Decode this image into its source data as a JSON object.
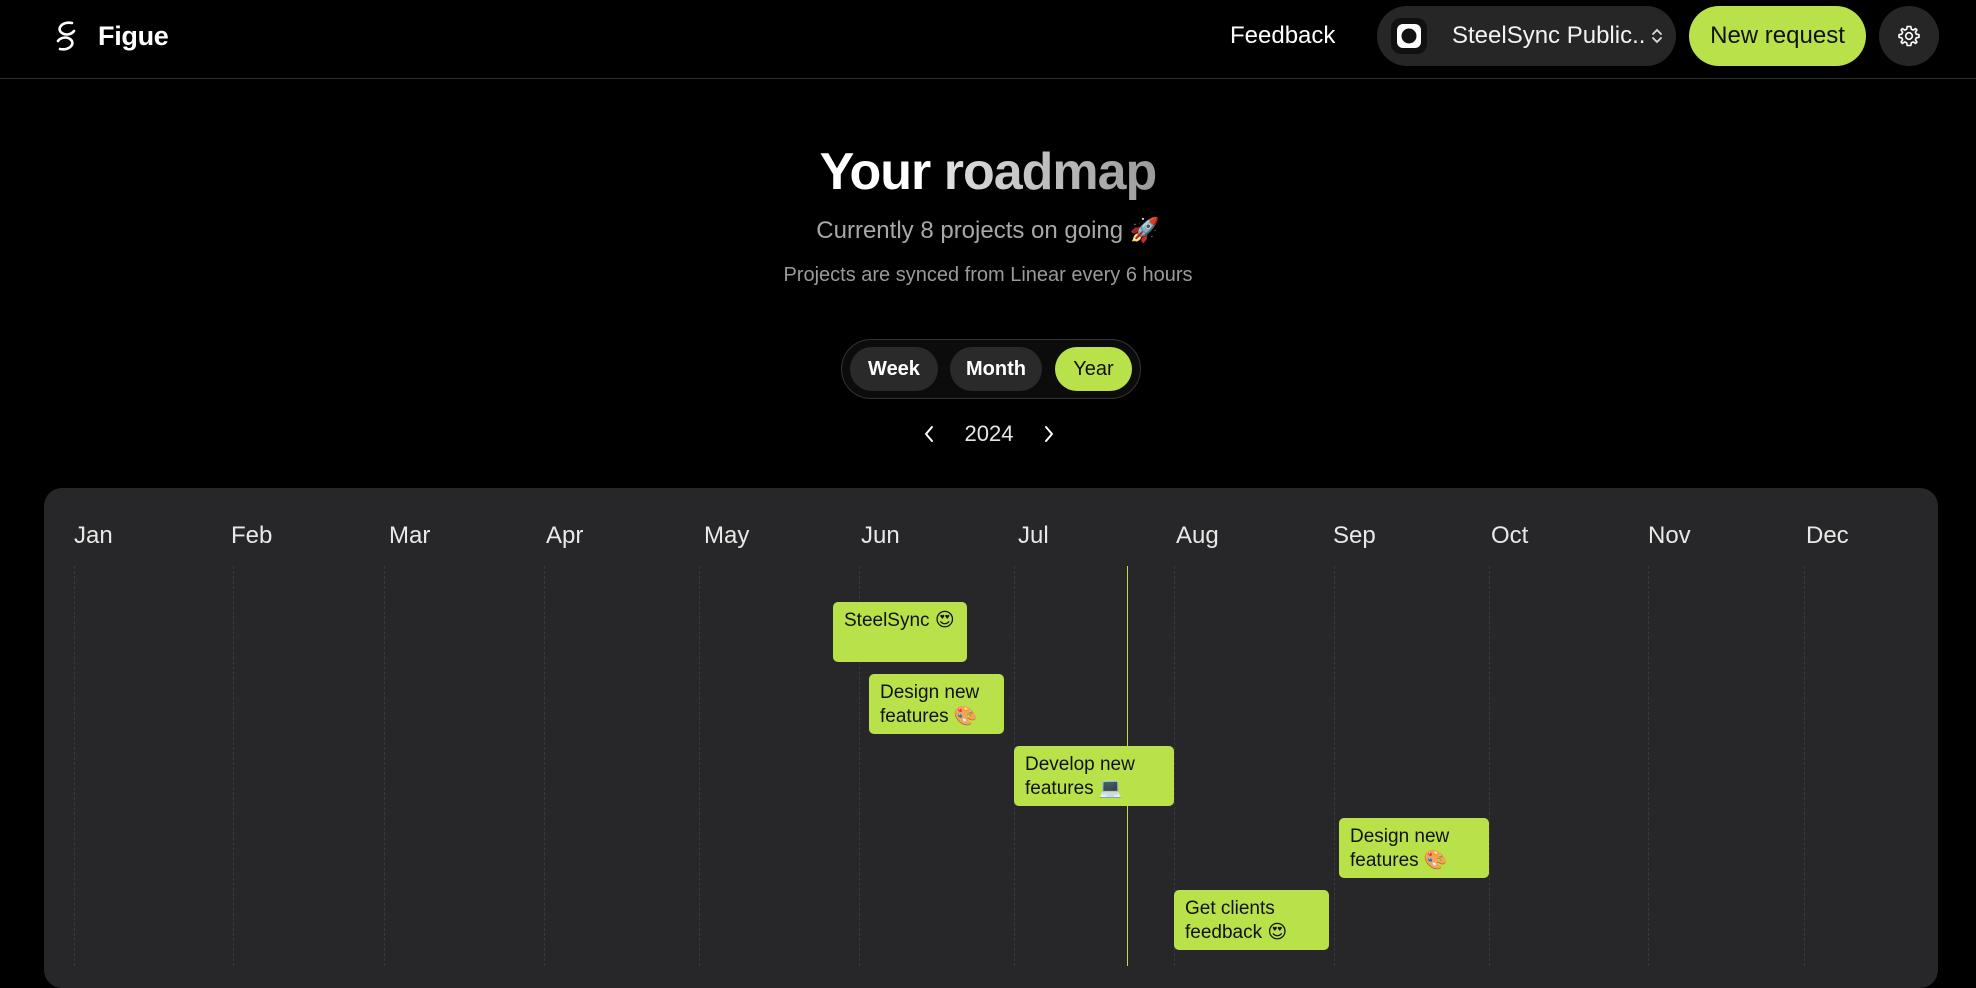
{
  "app": {
    "name": "Figue"
  },
  "topbar": {
    "feedback_label": "Feedback",
    "workspace_name": "SteelSync Public..",
    "new_request_label": "New request"
  },
  "hero": {
    "title_part1": "Your ",
    "title_part2": "roadmap",
    "subtitle": "Currently 8 projects on going 🚀",
    "note": "Projects are synced from Linear every 6 hours"
  },
  "view_switch": {
    "week": "Week",
    "month": "Month",
    "year": "Year",
    "active": "Year"
  },
  "year_nav": {
    "year": "2024"
  },
  "timeline": {
    "months": [
      "Jan",
      "Feb",
      "Mar",
      "Apr",
      "May",
      "Jun",
      "Jul",
      "Aug",
      "Sep",
      "Oct",
      "Nov",
      "Dec"
    ],
    "projects": [
      {
        "title": "SteelSync 😍"
      },
      {
        "title": "Design new features 🎨"
      },
      {
        "title": "Develop new features 💻"
      },
      {
        "title": "Design new features 🎨"
      },
      {
        "title": "Get clients feedback 😍"
      }
    ]
  },
  "colors": {
    "accent": "#b9e24a",
    "background": "#000000",
    "panel": "#272729"
  }
}
